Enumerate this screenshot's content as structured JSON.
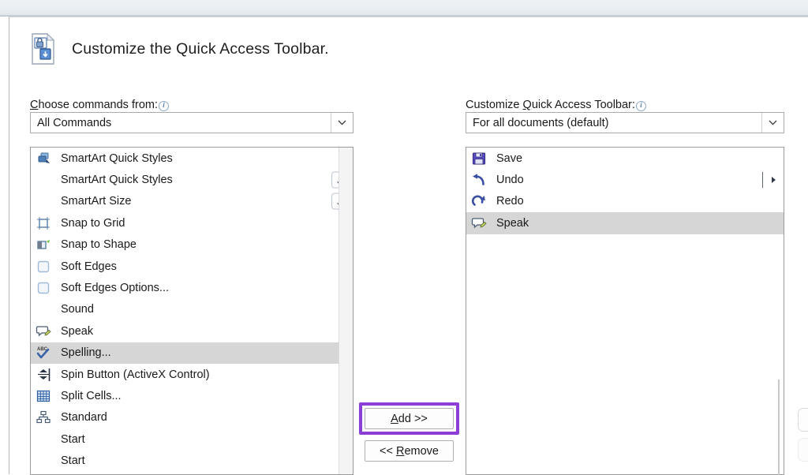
{
  "window": {
    "header_title": "Customize the Quick Access Toolbar.",
    "header_icon": "quick-access-toolbar-document-icon"
  },
  "left_panel": {
    "label_prefix": "",
    "label_mnemonic": "C",
    "label_text": "hoose commands from:",
    "info_icon": "info-icon",
    "combo": {
      "value": "All Commands",
      "arrow_icon": "chevron-down-icon"
    },
    "items": [
      {
        "label": "SmartArt Quick Styles",
        "icon": "smartart-styles-icon",
        "has_icon": true,
        "accessory": "submenu"
      },
      {
        "label": "SmartArt Quick Styles",
        "icon": "none",
        "has_icon": false,
        "accessory": "dropbox"
      },
      {
        "label": "SmartArt Size",
        "icon": "none",
        "has_icon": false,
        "accessory": "dropbox"
      },
      {
        "label": "Snap to Grid",
        "icon": "snap-to-grid-icon",
        "has_icon": true,
        "accessory": "none"
      },
      {
        "label": "Snap to Shape",
        "icon": "snap-to-shape-icon",
        "has_icon": true,
        "accessory": "none"
      },
      {
        "label": "Soft Edges",
        "icon": "soft-edges-icon",
        "has_icon": true,
        "accessory": "submenu"
      },
      {
        "label": "Soft Edges Options...",
        "icon": "soft-edges-icon",
        "has_icon": true,
        "accessory": "none"
      },
      {
        "label": "Sound",
        "icon": "none",
        "has_icon": false,
        "accessory": "submenu"
      },
      {
        "label": "Speak",
        "icon": "speak-icon",
        "has_icon": true,
        "accessory": "none"
      },
      {
        "label": "Spelling...",
        "icon": "spelling-icon",
        "has_icon": true,
        "accessory": "none",
        "selected": true
      },
      {
        "label": "Spin Button (ActiveX Control)",
        "icon": "spin-button-icon",
        "has_icon": true,
        "accessory": "none"
      },
      {
        "label": "Split Cells...",
        "icon": "split-cells-icon",
        "has_icon": true,
        "accessory": "none"
      },
      {
        "label": "Standard",
        "icon": "standard-org-icon",
        "has_icon": true,
        "accessory": "none"
      },
      {
        "label": "Start",
        "icon": "none",
        "has_icon": false,
        "accessory": "submenu"
      },
      {
        "label": "Start",
        "icon": "none",
        "has_icon": false,
        "accessory": "submenu"
      }
    ]
  },
  "right_panel": {
    "label_prefix": "Customize ",
    "label_mnemonic": "Q",
    "label_text": "uick Access Toolbar:",
    "info_icon": "info-icon",
    "combo": {
      "value": "For all documents (default)",
      "arrow_icon": "chevron-down-icon"
    },
    "items": [
      {
        "label": "Save",
        "icon": "save-disk-icon",
        "accessory": "none"
      },
      {
        "label": "Undo",
        "icon": "undo-arrow-icon",
        "accessory": "divider-submenu"
      },
      {
        "label": "Redo",
        "icon": "redo-arrow-icon",
        "accessory": "none"
      },
      {
        "label": "Speak",
        "icon": "speak-icon",
        "accessory": "none",
        "selected": true
      }
    ]
  },
  "middle_buttons": {
    "add_label": "Add >>",
    "add_mnemonic": "A",
    "remove_label": "<< Remove",
    "remove_mnemonic": "R",
    "highlight_color": "#8b3fd6"
  },
  "colors": {
    "selection_gray": "#d6d6d6",
    "border_gray": "#9b9b9b",
    "text": "#1a1a1a",
    "highlight_purple": "#8b3fd6",
    "top_strip": "#e9eef2"
  }
}
